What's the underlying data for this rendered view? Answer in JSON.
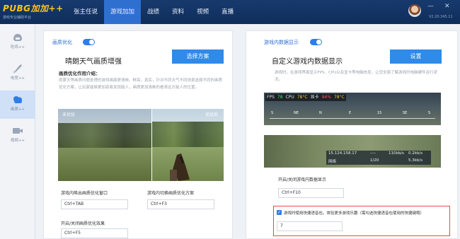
{
  "app": {
    "logo": "PUBG加加++",
    "logo_sub": "游戏专业辅助平台",
    "version": "V2.20.345.11"
  },
  "nav": {
    "tabs": [
      {
        "label": "张主任说",
        "active": false
      },
      {
        "label": "游戏加加",
        "active": true
      },
      {
        "label": "战绩",
        "active": false
      },
      {
        "label": "资料",
        "active": false
      },
      {
        "label": "视频",
        "active": false
      },
      {
        "label": "直播",
        "active": false
      }
    ],
    "window_controls": [
      "—",
      "✕"
    ]
  },
  "sidebar": {
    "items": [
      {
        "label": "吃鸡++",
        "icon": "helmet-icon",
        "active": false
      },
      {
        "label": "电竞++",
        "icon": "rocket-icon",
        "active": false
      },
      {
        "label": "画质++",
        "icon": "cloud-icon",
        "active": true
      },
      {
        "label": "视频++",
        "icon": "video-icon",
        "active": false
      }
    ]
  },
  "left_card": {
    "toggle_label": "画质优化",
    "toggle_on": true,
    "title": "晴朗天气画质增强",
    "button": "选择方案",
    "subhead": "画质优化作用介绍：",
    "description": "雨雾天等画质问题处理的游戏画面更清晰，鲜亮，真实，针对不同天气不同场景选择不同的画质优化方案，让玩家能够更加容易发现敌人，画质更加清晰的看清远方敌人的位置。",
    "image_tags": {
      "left": "未优化",
      "right": "优化后"
    },
    "fields": [
      {
        "label": "游戏内唤出画质优化窗口",
        "value": "Ctrl+TAB"
      },
      {
        "label": "游戏内切换画质优化方案",
        "value": "Ctrl+F3"
      },
      {
        "label": "开启/关闭画质优化效果",
        "value": "Ctrl+F5"
      }
    ]
  },
  "right_card": {
    "toggle_label": "游戏内数据显示",
    "toggle_on": true,
    "title": "自定义游戏内数据显示",
    "button": "设置",
    "description": "游戏时，在游戏界面显示FPS、CPU以及显卡等电脑信息，让您全面了解游戏时电脑硬件运行状况。",
    "hud": {
      "stats": [
        {
          "text": "FPS",
          "color": "#e0e6ec"
        },
        {
          "text": "78",
          "color": "#4fe06a"
        },
        {
          "text": "CPU",
          "color": "#e0e6ec"
        },
        {
          "text": "78°C",
          "color": "#ffcc33"
        },
        {
          "text": "显卡",
          "color": "#e0e6ec"
        },
        {
          "text": "94%",
          "color": "#ff5a5a"
        },
        {
          "text": "78°C",
          "color": "#ffcc33"
        }
      ],
      "compass": [
        "S",
        "NE",
        "N",
        "E",
        "15",
        "SE",
        "S"
      ]
    },
    "net": {
      "ip": "15.124.158.17",
      "ping": "----",
      "speed": "110kb/s",
      "loss": "1/20",
      "label": "网络",
      "up": "0.2kb/s",
      "down": "5.3kb/s"
    },
    "fields": [
      {
        "label": "开启/关闭游戏内数据显示",
        "value": "Ctrl+F10"
      }
    ],
    "quick_voice": {
      "checked": true,
      "label": "游戏时使用快捷语音包，体验更多游戏乐趣（需勾选快捷语音包使用的快捷键哦）",
      "value": "7"
    }
  }
}
